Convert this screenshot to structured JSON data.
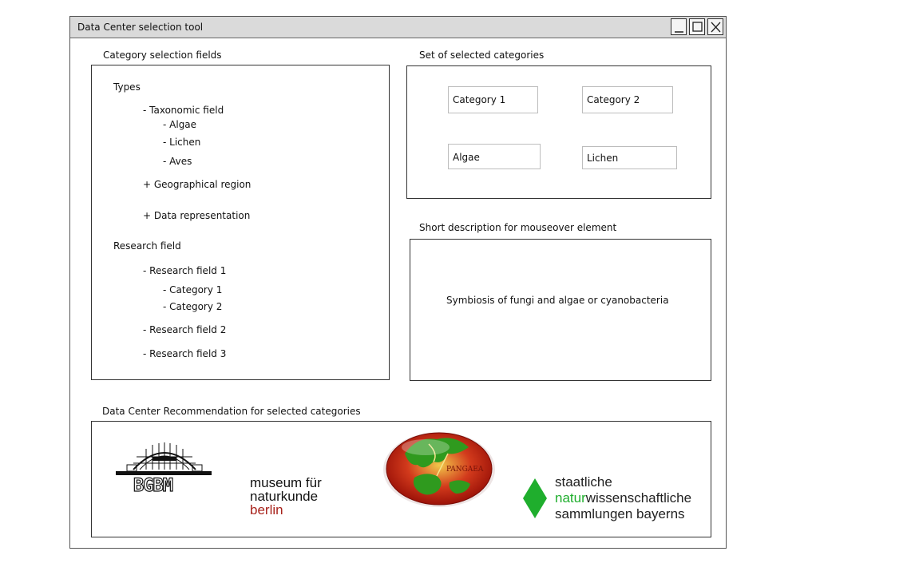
{
  "window": {
    "title": "Data Center selection tool",
    "controls": [
      "minimize-icon",
      "maximize-icon",
      "close-icon"
    ]
  },
  "category_panel": {
    "heading": "Category selection fields",
    "types_label": "Types",
    "taxonomic": "- Taxonomic field",
    "taxonomic_items": [
      "- Algae",
      "- Lichen",
      "- Aves"
    ],
    "geographical": "+ Geographical region",
    "data_representation": "+ Data representation",
    "research_label": "Research field",
    "research1": "- Research field 1",
    "research1_items": [
      "- Category 1",
      "- Category 2"
    ],
    "research2": "- Research field 2",
    "research3": "- Research field 3"
  },
  "selected_panel": {
    "heading": "Set of selected categories",
    "chips": [
      "Category 1",
      "Category 2",
      "Algae",
      "Lichen"
    ]
  },
  "description_panel": {
    "heading": "Short description for mouseover element",
    "text": "Symbiosis of fungi and algae or cyanobacteria"
  },
  "recommendation_panel": {
    "heading": "Data Center Recommendation for selected categories",
    "bgbm": {
      "text": "BGBM"
    },
    "mfn": {
      "line1": "museum für",
      "line2": "naturkunde",
      "line3": "berlin",
      "line3_color": "#a8231c"
    },
    "pangaea": {
      "text": "PANGAEA"
    },
    "snsb": {
      "line1": "staatliche",
      "line2_a": "natur",
      "line2_b": "wissenschaftliche",
      "line3": "sammlungen bayerns",
      "accent": "#1fae2d"
    }
  }
}
